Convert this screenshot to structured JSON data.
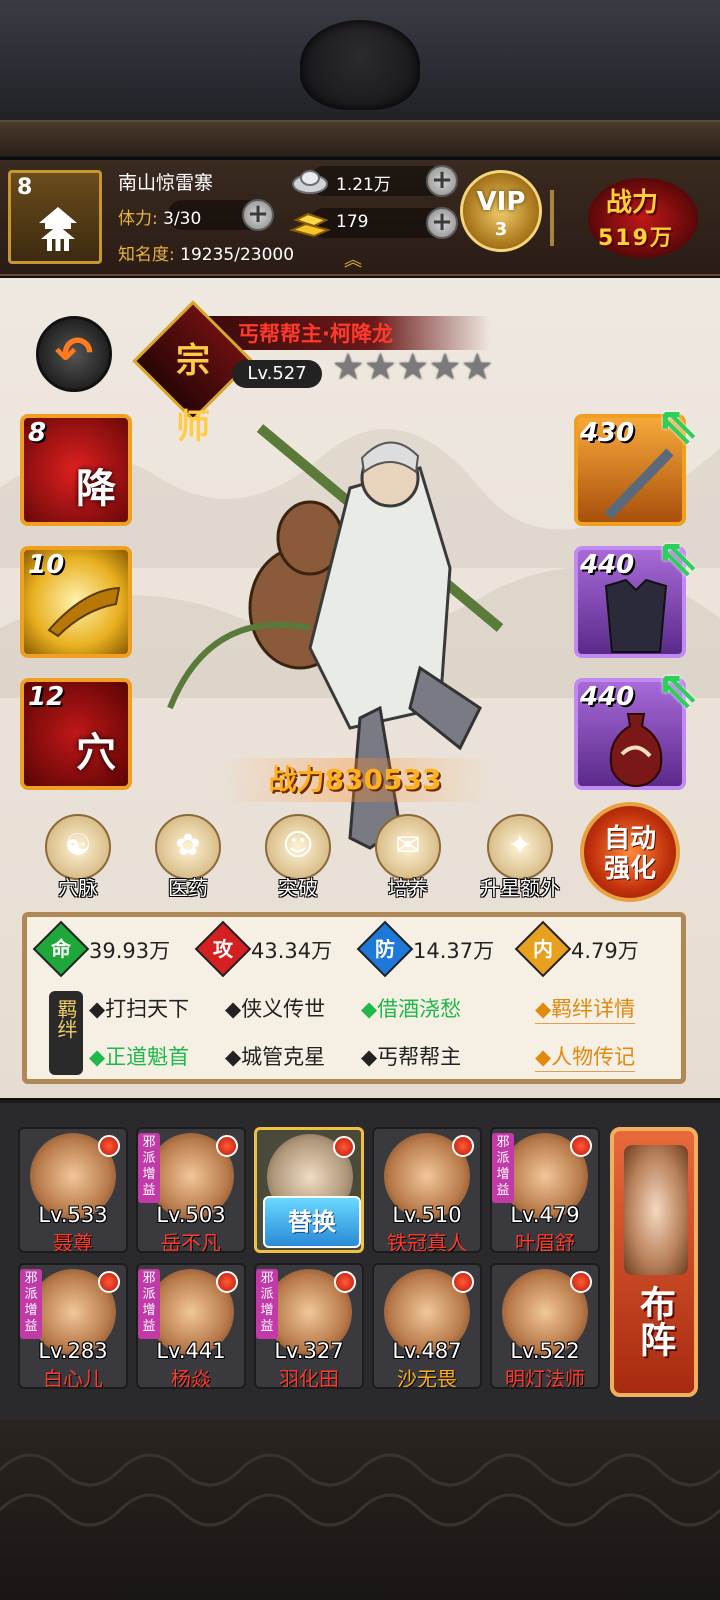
{
  "header": {
    "rank": "8",
    "stronghold_name": "南山惊雷寨",
    "stamina_label": "体力:",
    "stamina_value": "3/30",
    "fame_label": "知名度:",
    "fame_value": "19235/23000",
    "silver": "1.21万",
    "gold": "179",
    "vip_text": "VIP",
    "vip_level": "3",
    "power_label": "战力",
    "power_value": "519万"
  },
  "character": {
    "title": "丐帮帮主·柯降龙",
    "level": "Lv.527",
    "stars_total": 5,
    "stars_filled": 0,
    "emblem": "宗师",
    "combat_power": "战力830533"
  },
  "skills": [
    {
      "level": "8",
      "glyph": "降",
      "color": "#c21818"
    },
    {
      "level": "10",
      "glyph": "",
      "color": "#e8b020"
    },
    {
      "level": "12",
      "glyph": "穴",
      "color": "#b01010"
    }
  ],
  "equipment": [
    {
      "level": "430",
      "icon": "sword-icon",
      "rarity": "orange"
    },
    {
      "level": "440",
      "icon": "armor-icon",
      "rarity": "purple"
    },
    {
      "level": "440",
      "icon": "vase-icon",
      "rarity": "purple"
    }
  ],
  "menu": [
    {
      "label": "穴脉",
      "icon": "meridian-icon"
    },
    {
      "label": "医药",
      "icon": "herb-icon"
    },
    {
      "label": "突破",
      "icon": "breakthrough-icon"
    },
    {
      "label": "培养",
      "icon": "scroll-icon"
    },
    {
      "label": "升星额外",
      "icon": "star-up-icon"
    }
  ],
  "auto_button": {
    "line1": "自动",
    "line2": "强化"
  },
  "stats": [
    {
      "glyph": "命",
      "value": "39.93万",
      "color": "#1fa83a"
    },
    {
      "glyph": "攻",
      "value": "43.34万",
      "color": "#d42020"
    },
    {
      "glyph": "防",
      "value": "14.37万",
      "color": "#1e78d8"
    },
    {
      "glyph": "内",
      "value": "4.79万",
      "color": "#e8a020"
    }
  ],
  "bonds": {
    "seal": "羁绊",
    "row1": [
      {
        "text": "◆打扫天下",
        "active": false
      },
      {
        "text": "◆侠义传世",
        "active": false
      },
      {
        "text": "◆借酒浇愁",
        "active": true
      }
    ],
    "row2": [
      {
        "text": "◆正道魁首",
        "active": true
      },
      {
        "text": "◆城管克星",
        "active": false
      },
      {
        "text": "◆丐帮帮主",
        "active": false
      }
    ],
    "link1": "◆羁绊详情",
    "link2": "◆人物传记"
  },
  "team": [
    {
      "level": "Lv.533",
      "name": "聂尊",
      "evil": false
    },
    {
      "level": "Lv.503",
      "name": "岳不凡",
      "evil": true
    },
    {
      "level": "",
      "name": "",
      "evil": false,
      "selected": true
    },
    {
      "level": "Lv.510",
      "name": "铁冠真人",
      "evil": false
    },
    {
      "level": "Lv.479",
      "name": "叶眉舒",
      "evil": true
    },
    {
      "level": "Lv.283",
      "name": "白心儿",
      "evil": true
    },
    {
      "level": "Lv.441",
      "name": "杨焱",
      "evil": true
    },
    {
      "level": "Lv.327",
      "name": "羽化田",
      "evil": true
    },
    {
      "level": "Lv.487",
      "name": "沙无畏",
      "evil": false
    },
    {
      "level": "Lv.522",
      "name": "明灯法师",
      "evil": false
    }
  ],
  "evil_tag": "邪派增益",
  "swap_label": "替换",
  "formation_label": "布阵"
}
